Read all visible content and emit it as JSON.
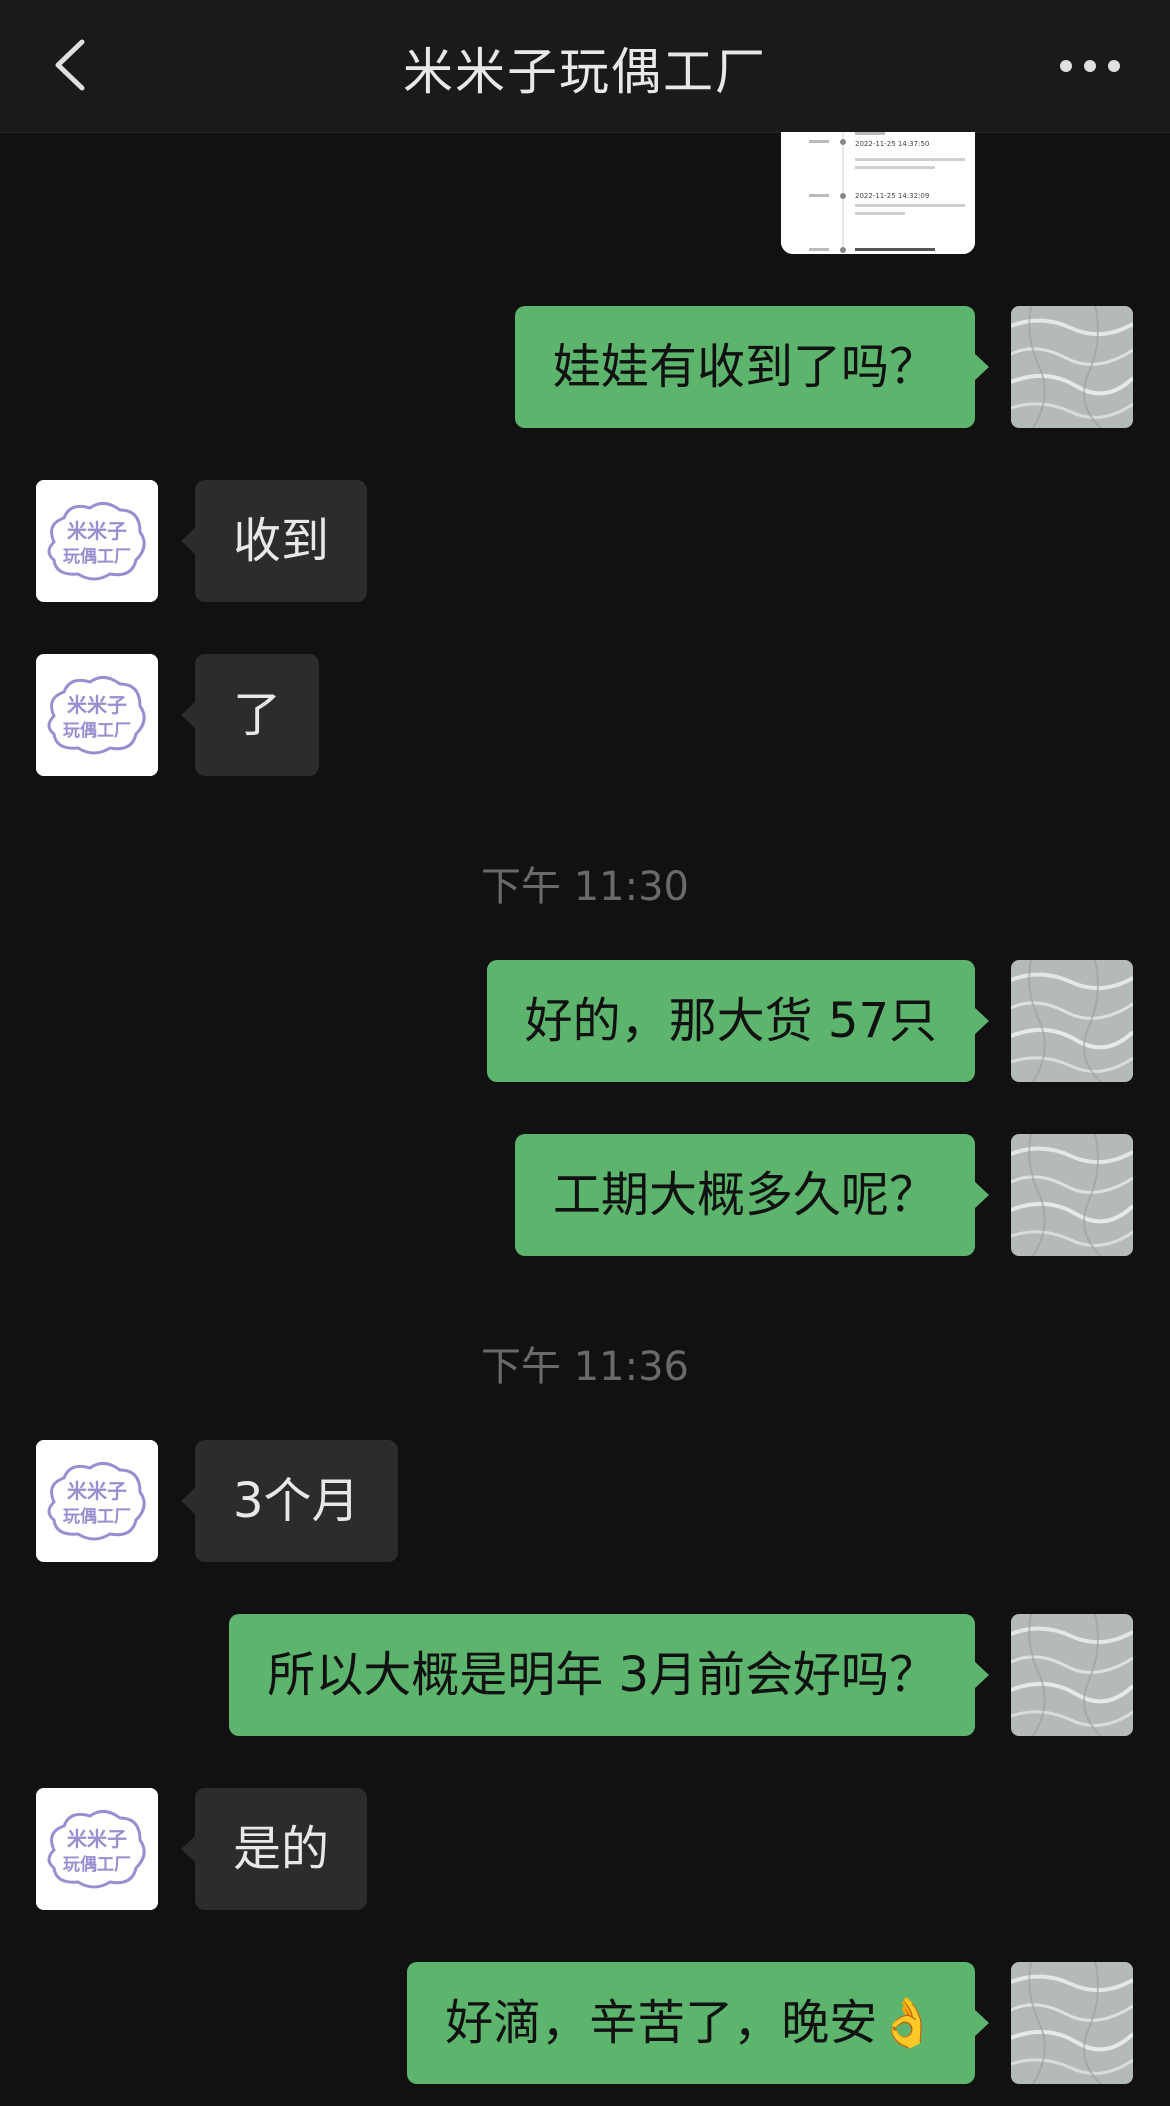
{
  "header": {
    "title": "米米子玩偶工厂",
    "back_icon": "chevron-left-icon",
    "more_icon": "more-dots-icon"
  },
  "avatars": {
    "them_logo_text_line1": "米米子",
    "them_logo_text_line2": "玩偶工厂"
  },
  "messages": {
    "m1": "娃娃有收到了吗？",
    "m2": "收到",
    "m3": "了",
    "ts1": "下午 11:30",
    "m4": "好的，那大货 57只",
    "m5": "工期大概多久呢？",
    "ts2": "下午 11:36",
    "m6": "3个月",
    "m7": "所以大概是明年 3月前会好吗？",
    "m8": "是的",
    "m9": "好滴，辛苦了，晚安👌"
  },
  "image_message": {
    "row1_date": "2022-11-25 14:37:50",
    "row2_date": "2022-11-25 14:32:09"
  },
  "colors": {
    "background": "#111111",
    "outgoing_bubble": "#5cb46d",
    "incoming_bubble": "#2c2c2c",
    "avatar_logo": "#9a8ed0"
  }
}
